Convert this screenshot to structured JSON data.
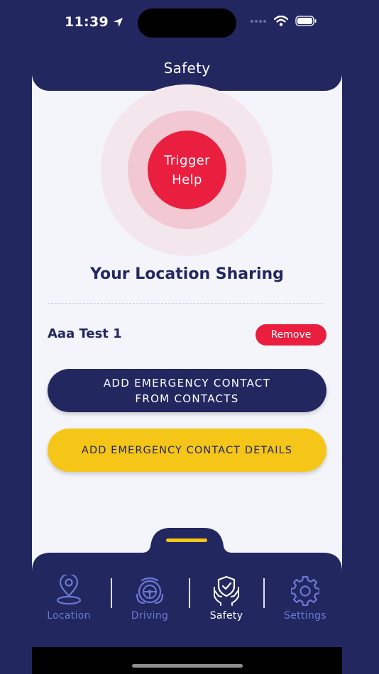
{
  "status_bar": {
    "time": "11:39"
  },
  "header": {
    "title": "Safety"
  },
  "trigger": {
    "line1": "Trigger",
    "line2": "Help"
  },
  "section": {
    "title": "Your Location Sharing"
  },
  "contacts": [
    {
      "name": "Aaa Test 1",
      "remove_label": "Remove"
    }
  ],
  "actions": {
    "add_from_contacts": "ADD EMERGENCY CONTACT\nFROM CONTACTS",
    "add_details": "ADD EMERGENCY CONTACT DETAILS"
  },
  "nav": {
    "items": [
      {
        "label": "Location",
        "icon": "location-pin-icon",
        "active": false
      },
      {
        "label": "Driving",
        "icon": "steering-wheel-icon",
        "active": false
      },
      {
        "label": "Safety",
        "icon": "shield-hands-icon",
        "active": true
      },
      {
        "label": "Settings",
        "icon": "gear-icon",
        "active": false
      }
    ]
  },
  "colors": {
    "navy": "#232760",
    "red": "#ea1e3f",
    "yellow": "#f5c617",
    "nav_inactive": "#6b79d4"
  }
}
